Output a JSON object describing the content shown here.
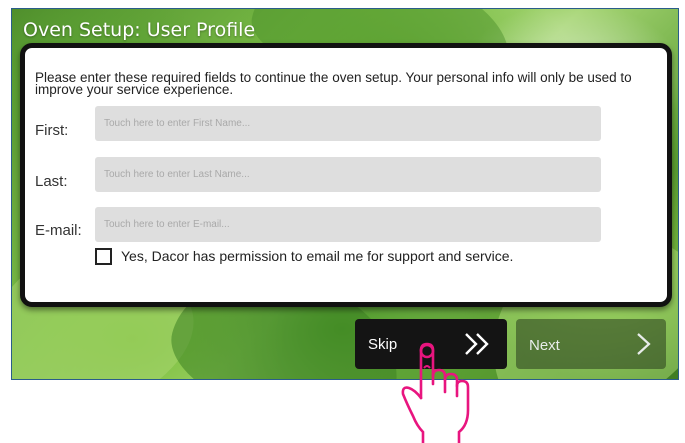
{
  "screen": {
    "title": "Oven Setup: User Profile"
  },
  "form": {
    "intro": "Please enter these required fields to continue the oven setup. Your personal info will only be used to improve your service experience.",
    "fields": [
      {
        "label": "First:",
        "placeholder": "Touch here to enter First Name..."
      },
      {
        "label": "Last:",
        "placeholder": "Touch here to enter Last Name..."
      },
      {
        "label": "E-mail:",
        "placeholder": "Touch here to enter E-mail..."
      }
    ],
    "permission": {
      "checked": false,
      "label": "Yes, Dacor has permission to email me for support and service."
    }
  },
  "buttons": {
    "skip": {
      "label": "Skip",
      "icon": "double-chevron-right-icon"
    },
    "next": {
      "label": "Next",
      "icon": "chevron-right-icon"
    }
  },
  "overlay": {
    "icon": "pointing-hand-icon",
    "color": "#e8157f"
  }
}
